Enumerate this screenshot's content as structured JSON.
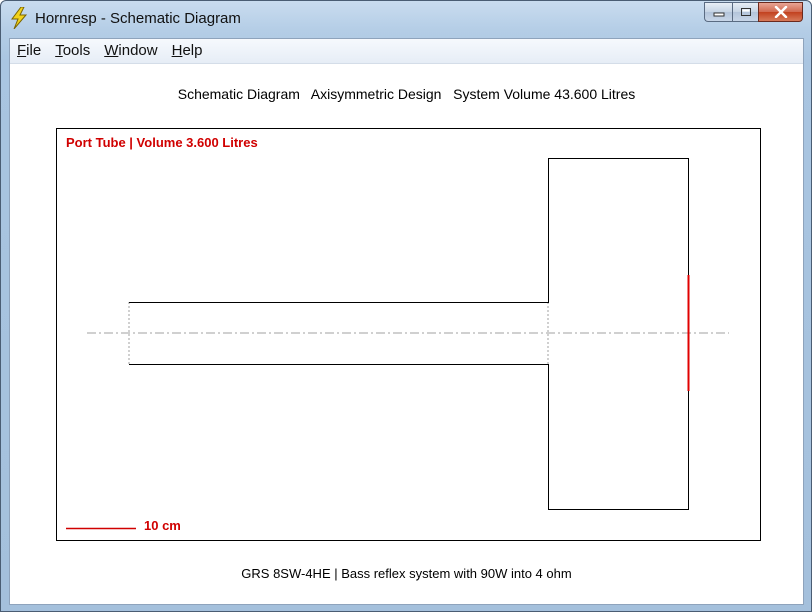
{
  "window": {
    "title": "Hornresp - Schematic Diagram",
    "icon": "lightning-bolt-icon"
  },
  "caption_buttons": {
    "minimize": "minimize-icon",
    "maximize": "maximize-icon",
    "close": "close-icon"
  },
  "menu": {
    "items": [
      {
        "first": "F",
        "rest": "ile"
      },
      {
        "first": "T",
        "rest": "ools"
      },
      {
        "first": "W",
        "rest": "indow"
      },
      {
        "first": "H",
        "rest": "elp"
      }
    ]
  },
  "header": {
    "text": "Schematic Diagram   Axisymmetric Design   System Volume 43.600 Litres"
  },
  "diagram": {
    "port_label": "Port Tube | Volume 3.600 Litres",
    "scale_label": "10 cm",
    "colors": {
      "outline": "#000000",
      "label": "#d00000",
      "driver": "#e00000",
      "centerline": "#a0a0a0"
    }
  },
  "footer": {
    "text": "GRS 8SW-4HE | Bass reflex system with 90W into 4 ohm"
  }
}
